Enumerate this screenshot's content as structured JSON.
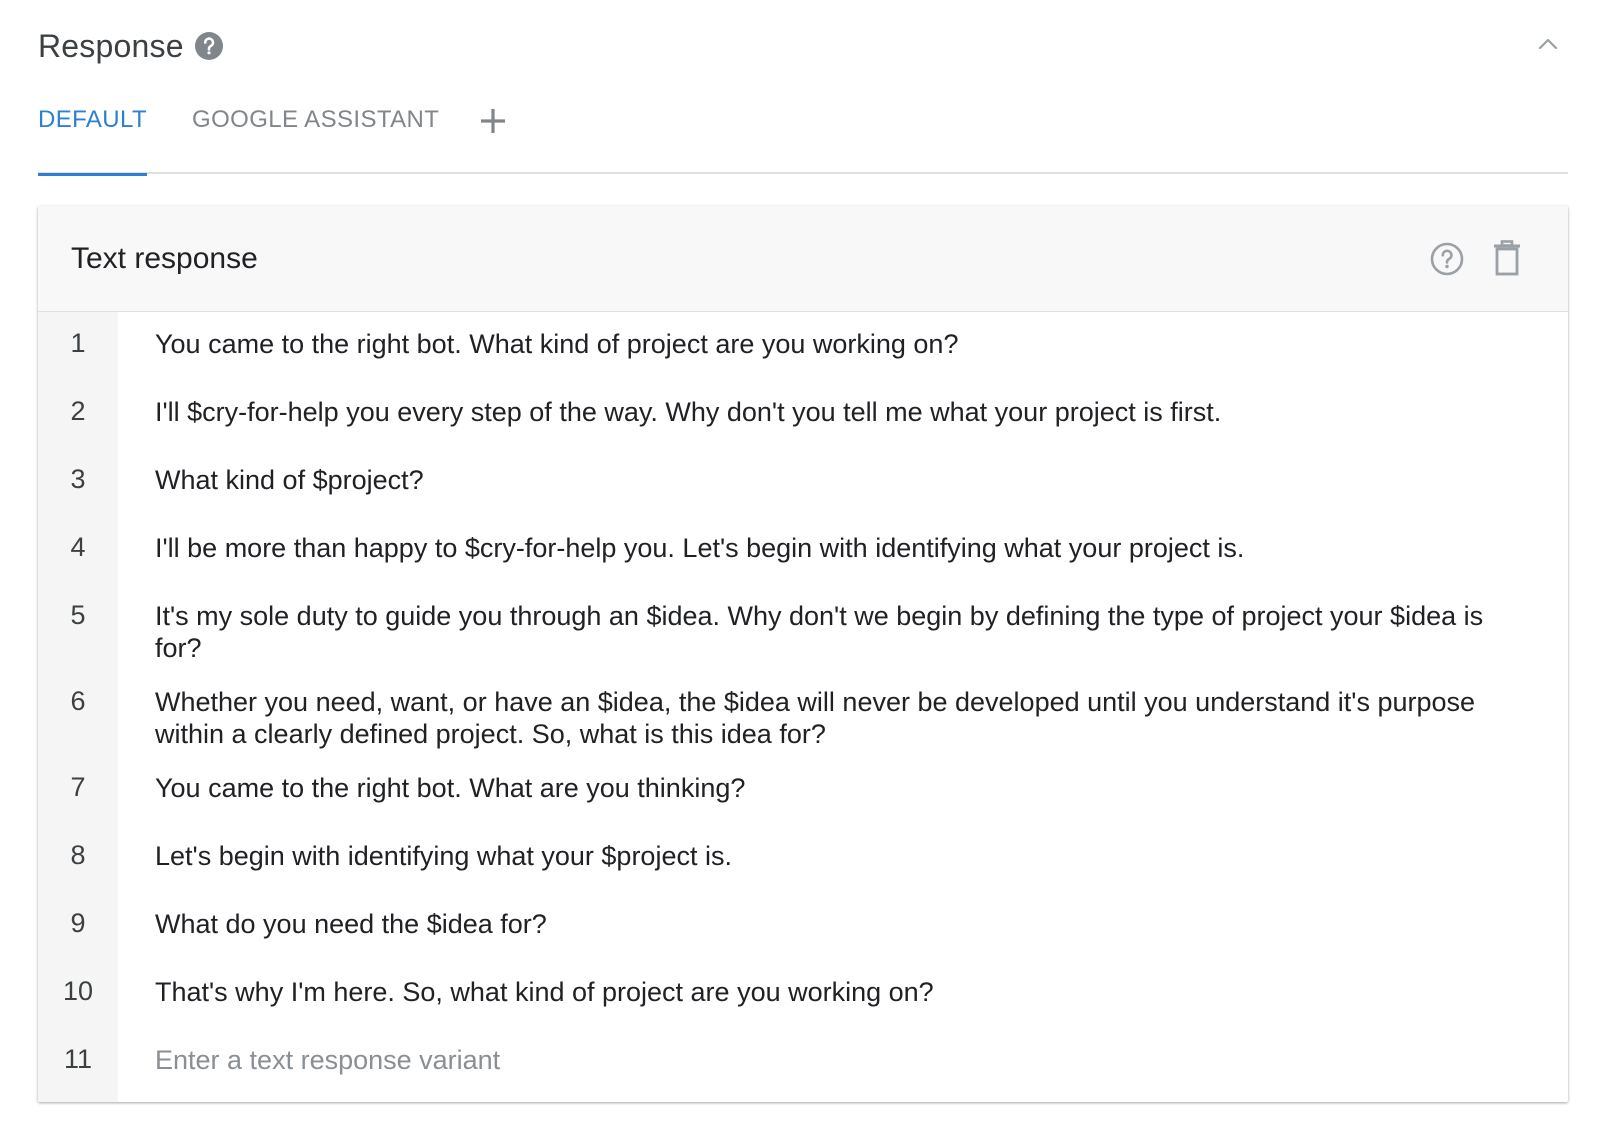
{
  "section": {
    "title": "Response"
  },
  "tabs": [
    {
      "label": "DEFAULT",
      "active": true
    },
    {
      "label": "GOOGLE ASSISTANT",
      "active": false
    }
  ],
  "card": {
    "title": "Text response",
    "rows": [
      {
        "num": "1",
        "text": "You came to the right bot. What kind of project are you working on?"
      },
      {
        "num": "2",
        "text": "I'll $cry-for-help you every step of the way. Why don't you tell me what your project is first."
      },
      {
        "num": "3",
        "text": "What kind of $project?"
      },
      {
        "num": "4",
        "text": "I'll be more than happy to $cry-for-help you. Let's begin with identifying what your project is."
      },
      {
        "num": "5",
        "text": "It's my sole duty to guide you through an $idea. Why don't we begin by defining the type of project your $idea is for?"
      },
      {
        "num": "6",
        "text": "Whether you need, want, or have an $idea, the $idea will never be developed until you understand it's purpose within a clearly defined project. So, what is this idea for?"
      },
      {
        "num": "7",
        "text": "You came to the right bot. What are you thinking?"
      },
      {
        "num": "8",
        "text": "Let's begin with identifying what your $project is."
      },
      {
        "num": "9",
        "text": "What do you need the $idea for?"
      },
      {
        "num": "10",
        "text": "That's why I'm here. So, what kind of project are you working on?"
      }
    ],
    "new_row": {
      "num": "11",
      "placeholder": "Enter a text response variant"
    }
  },
  "colors": {
    "accent": "#2d7fd3",
    "tab_inactive": "#80868b",
    "icon_gray": "#9aa0a6"
  },
  "icons": {
    "help": "help-circle-icon",
    "collapse": "chevron-up-icon",
    "add_tab": "plus-icon",
    "card_help": "help-outline-icon",
    "delete": "trash-icon"
  }
}
